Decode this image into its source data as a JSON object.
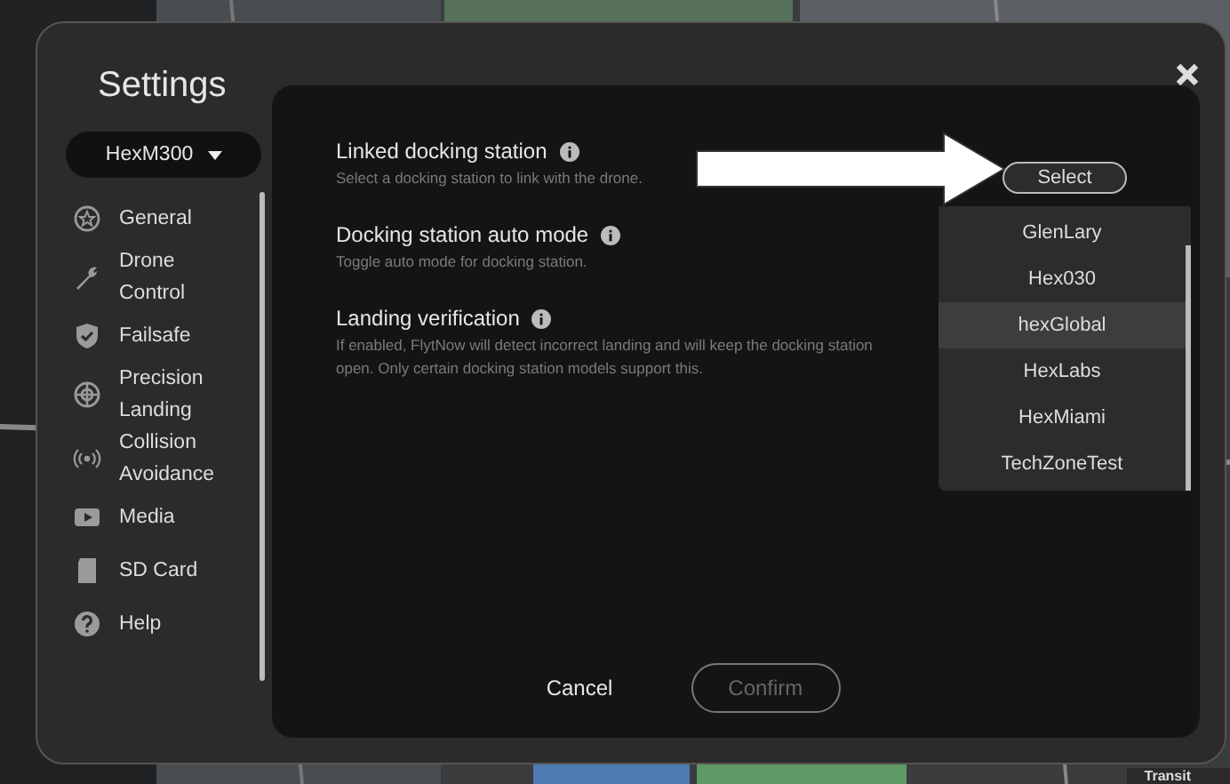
{
  "window": {
    "title": "Settings"
  },
  "drone_selector": {
    "value": "HexM300"
  },
  "sidebar": {
    "items": [
      {
        "label": "General"
      },
      {
        "label": "Drone Control"
      },
      {
        "label": "Failsafe"
      },
      {
        "label": "Precision Landing"
      },
      {
        "label": "Collision Avoidance"
      },
      {
        "label": "Media"
      },
      {
        "label": "SD Card"
      },
      {
        "label": "Help"
      }
    ]
  },
  "settings": [
    {
      "title": "Linked docking station",
      "description": "Select a docking station to link with the drone."
    },
    {
      "title": "Docking station auto mode",
      "description": "Toggle auto mode for docking station."
    },
    {
      "title": "Landing verification",
      "description": "If enabled, FlytNow will detect incorrect landing and will keep the docking station open. Only certain docking station models support this."
    }
  ],
  "station_select": {
    "label": "Select",
    "options": [
      {
        "label": "GlenLary",
        "selected": false
      },
      {
        "label": "Hex030",
        "selected": false
      },
      {
        "label": "hexGlobal",
        "selected": true
      },
      {
        "label": "HexLabs",
        "selected": false
      },
      {
        "label": "HexMiami",
        "selected": false
      },
      {
        "label": "TechZoneTest",
        "selected": false
      }
    ]
  },
  "buttons": [
    {
      "label": "Cancel",
      "kind": "text",
      "disabled": false
    },
    {
      "label": "Confirm",
      "kind": "outline",
      "disabled": true
    }
  ],
  "map_controls": [
    "Transit"
  ]
}
